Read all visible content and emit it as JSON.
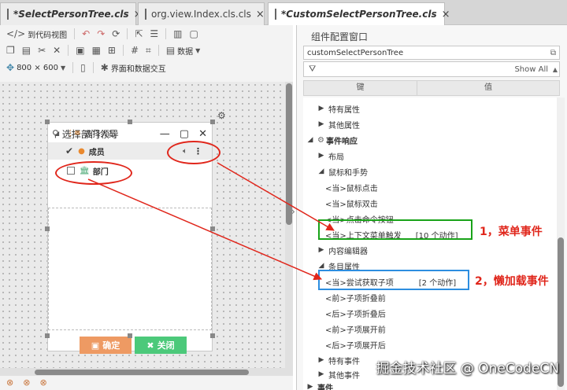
{
  "tabs": [
    {
      "title": "*SelectPersonTree.cls",
      "active": false
    },
    {
      "title": "org.view.Index.cls.cls",
      "active": false
    },
    {
      "title": "*CustomSelectPersonTree.cls",
      "active": true
    }
  ],
  "toolbar": {
    "code_view_label": "到代码视图",
    "data_label": "数据",
    "size_label": "800 × 600",
    "interaction_label": "界面和数据交互"
  },
  "dialog": {
    "title": "选择部门领导",
    "tree": [
      {
        "label": "选择人员"
      },
      {
        "label": "成员"
      },
      {
        "label": "部门"
      }
    ],
    "confirm_label": "确定",
    "close_label": "关闭"
  },
  "panel": {
    "title": "组件配置窗口",
    "component_name": "customSelectPersonTree",
    "show_all": "Show All",
    "col_key": "键",
    "col_value": "值",
    "rows": [
      {
        "label": "特有属性",
        "value": ""
      },
      {
        "label": "其他属性",
        "value": ""
      },
      {
        "label": "事件响应",
        "value": ""
      },
      {
        "label": "布局",
        "value": ""
      },
      {
        "label": "鼠标和手势",
        "value": ""
      },
      {
        "label": "<当>鼠标点击",
        "value": ""
      },
      {
        "label": "<当>鼠标双击",
        "value": ""
      },
      {
        "label": "<当>点击命令按钮",
        "value": ""
      },
      {
        "label": "<当>上下文菜单触发",
        "value": "[10 个动作]"
      },
      {
        "label": "内容编辑器",
        "value": ""
      },
      {
        "label": "条目属性",
        "value": ""
      },
      {
        "label": "<当>尝试获取子项",
        "value": "[2 个动作]"
      },
      {
        "label": "<前>子项折叠前",
        "value": ""
      },
      {
        "label": "<后>子项折叠后",
        "value": ""
      },
      {
        "label": "<前>子项展开前",
        "value": ""
      },
      {
        "label": "<后>子项展开后",
        "value": ""
      },
      {
        "label": "特有事件",
        "value": ""
      },
      {
        "label": "其他事件",
        "value": ""
      },
      {
        "label": "事件",
        "value": ""
      }
    ]
  },
  "annotations": {
    "label1": "1，菜单事件",
    "label2": "2，懒加载事件",
    "green": "#19a319",
    "blue": "#2d8ee0",
    "red": "#e0261b"
  },
  "watermark": "掘金技术社区 @ OneCodeCN",
  "colors": {
    "confirm_button": "#ee9a63",
    "close_button": "#4cc97a",
    "person_icon": "#e9892e",
    "dept_icon": "#3fa36c"
  }
}
